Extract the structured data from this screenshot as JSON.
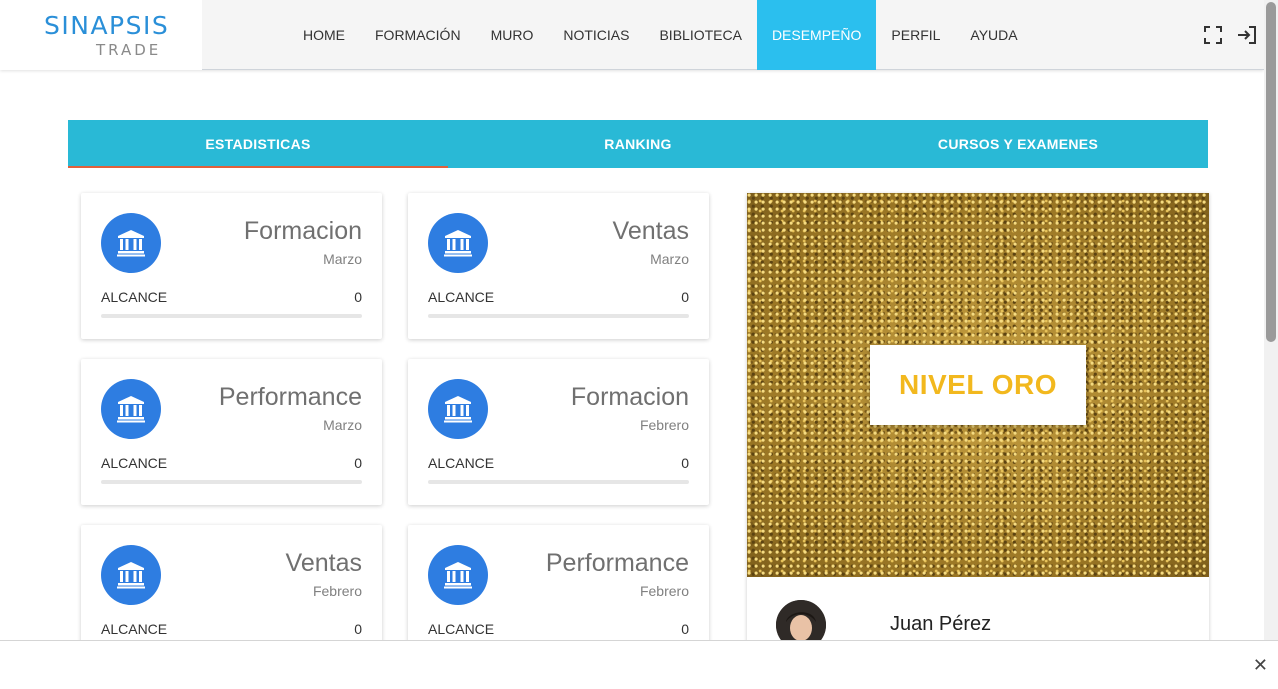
{
  "brand": {
    "line1": "SINAPSIS",
    "line2": "TRADE"
  },
  "nav": [
    {
      "label": "HOME"
    },
    {
      "label": "FORMACIÓN"
    },
    {
      "label": "MURO"
    },
    {
      "label": "NOTICIAS"
    },
    {
      "label": "BIBLIOTECA"
    },
    {
      "label": "DESEMPEÑO",
      "active": true
    },
    {
      "label": "PERFIL"
    },
    {
      "label": "AYUDA"
    }
  ],
  "header_icons": [
    "fullscreen-icon",
    "logout-icon"
  ],
  "tabs": [
    {
      "label": "ESTADISTICAS",
      "active": true
    },
    {
      "label": "RANKING"
    },
    {
      "label": "CURSOS Y EXAMENES"
    }
  ],
  "cards": [
    {
      "title": "Formacion",
      "month": "Marzo",
      "reach_label": "ALCANCE",
      "reach_value": "0",
      "progress": 0
    },
    {
      "title": "Ventas",
      "month": "Marzo",
      "reach_label": "ALCANCE",
      "reach_value": "0",
      "progress": 0
    },
    {
      "title": "Performance",
      "month": "Marzo",
      "reach_label": "ALCANCE",
      "reach_value": "0",
      "progress": 0
    },
    {
      "title": "Formacion",
      "month": "Febrero",
      "reach_label": "ALCANCE",
      "reach_value": "0",
      "progress": 0
    },
    {
      "title": "Ventas",
      "month": "Febrero",
      "reach_label": "ALCANCE",
      "reach_value": "0",
      "progress": 0
    },
    {
      "title": "Performance",
      "month": "Febrero",
      "reach_label": "ALCANCE",
      "reach_value": "0",
      "progress": 0
    }
  ],
  "level_badge": "NIVEL ORO",
  "user": {
    "name": "Juan Pérez"
  },
  "colors": {
    "accent": "#2bbfee",
    "tabs": "#29b9d6",
    "tab_indicator": "#e0603c",
    "icon_circle": "#2e7de1",
    "gold_text": "#f2b81e"
  }
}
